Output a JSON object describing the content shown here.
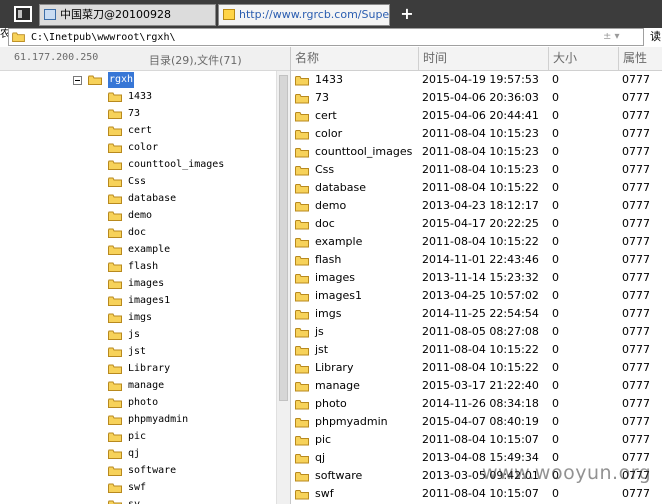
{
  "browser": {
    "tabs": [
      {
        "label": "中国菜刀@20100928",
        "active": false
      },
      {
        "label": "http://www.rgrcb.com/Super...",
        "active": true
      }
    ],
    "new_tab_label": "+",
    "left_edge_text": "农",
    "right_edge_text": "读"
  },
  "pathbar": {
    "path": "C:\\Inetpub\\wwwroot\\rgxh\\",
    "controls": "±  ▾"
  },
  "left_panel": {
    "ip": "61.177.200.250",
    "stats": "目录(29),文件(71)",
    "tree_root": "rgxh",
    "tree_children": [
      "1433",
      "73",
      "cert",
      "color",
      "counttool_images",
      "Css",
      "database",
      "demo",
      "doc",
      "example",
      "flash",
      "images",
      "images1",
      "imgs",
      "js",
      "jst",
      "Library",
      "manage",
      "photo",
      "phpmyadmin",
      "pic",
      "qj",
      "software",
      "swf",
      "sy"
    ]
  },
  "file_list": {
    "headers": {
      "name": "名称",
      "time": "时间",
      "size": "大小",
      "attr": "属性"
    },
    "rows": [
      {
        "name": "1433",
        "time": "2015-04-19 19:57:53",
        "size": "0",
        "attr": "0777"
      },
      {
        "name": "73",
        "time": "2015-04-06 20:36:03",
        "size": "0",
        "attr": "0777"
      },
      {
        "name": "cert",
        "time": "2015-04-06 20:44:41",
        "size": "0",
        "attr": "0777"
      },
      {
        "name": "color",
        "time": "2011-08-04 10:15:23",
        "size": "0",
        "attr": "0777"
      },
      {
        "name": "counttool_images",
        "time": "2011-08-04 10:15:23",
        "size": "0",
        "attr": "0777"
      },
      {
        "name": "Css",
        "time": "2011-08-04 10:15:23",
        "size": "0",
        "attr": "0777"
      },
      {
        "name": "database",
        "time": "2011-08-04 10:15:22",
        "size": "0",
        "attr": "0777"
      },
      {
        "name": "demo",
        "time": "2013-04-23 18:12:17",
        "size": "0",
        "attr": "0777"
      },
      {
        "name": "doc",
        "time": "2015-04-17 20:22:25",
        "size": "0",
        "attr": "0777"
      },
      {
        "name": "example",
        "time": "2011-08-04 10:15:22",
        "size": "0",
        "attr": "0777"
      },
      {
        "name": "flash",
        "time": "2014-11-01 22:43:46",
        "size": "0",
        "attr": "0777"
      },
      {
        "name": "images",
        "time": "2013-11-14 15:23:32",
        "size": "0",
        "attr": "0777"
      },
      {
        "name": "images1",
        "time": "2013-04-25 10:57:02",
        "size": "0",
        "attr": "0777"
      },
      {
        "name": "imgs",
        "time": "2014-11-25 22:54:54",
        "size": "0",
        "attr": "0777"
      },
      {
        "name": "js",
        "time": "2011-08-05 08:27:08",
        "size": "0",
        "attr": "0777"
      },
      {
        "name": "jst",
        "time": "2011-08-04 10:15:22",
        "size": "0",
        "attr": "0777"
      },
      {
        "name": "Library",
        "time": "2011-08-04 10:15:22",
        "size": "0",
        "attr": "0777"
      },
      {
        "name": "manage",
        "time": "2015-03-17 21:22:40",
        "size": "0",
        "attr": "0777"
      },
      {
        "name": "photo",
        "time": "2014-11-26 08:34:18",
        "size": "0",
        "attr": "0777"
      },
      {
        "name": "phpmyadmin",
        "time": "2015-04-07 08:40:19",
        "size": "0",
        "attr": "0777"
      },
      {
        "name": "pic",
        "time": "2011-08-04 10:15:07",
        "size": "0",
        "attr": "0777"
      },
      {
        "name": "qj",
        "time": "2013-04-08 15:49:34",
        "size": "0",
        "attr": "0777"
      },
      {
        "name": "software",
        "time": "2013-03-05 09:42:01",
        "size": "0",
        "attr": "0777"
      },
      {
        "name": "swf",
        "time": "2011-08-04 10:15:07",
        "size": "0",
        "attr": "0777"
      }
    ]
  },
  "watermark": "www.wooyun.org",
  "icons": {
    "folder": "folder-icon",
    "window": "window-icon",
    "page": "page-icon"
  },
  "colors": {
    "folder_fill": "#f7d25a",
    "folder_stroke": "#b8891e",
    "selection": "#3877d6",
    "tabbar": "#3c3c3c",
    "url_text": "#2a5db0",
    "header_text": "#6a6a6a"
  }
}
